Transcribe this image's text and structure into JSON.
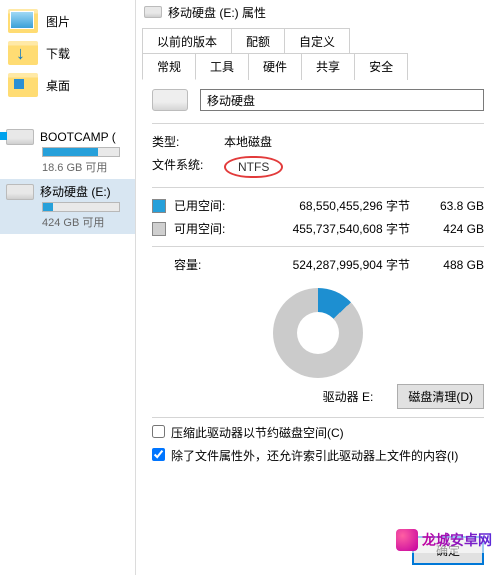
{
  "sidebar": {
    "items": [
      {
        "label": "图片"
      },
      {
        "label": "下载"
      },
      {
        "label": "桌面"
      }
    ],
    "drives": [
      {
        "name": "BOOTCAMP (",
        "meta": "18.6 GB 可用",
        "fill": 72
      },
      {
        "name": "移动硬盘 (E:)",
        "meta": "424 GB 可用",
        "fill": 13
      }
    ]
  },
  "dialog": {
    "title": "移动硬盘 (E:) 属性",
    "tabs_top": [
      "以前的版本",
      "配额",
      "自定义"
    ],
    "tabs_bottom": [
      "常规",
      "工具",
      "硬件",
      "共享",
      "安全"
    ],
    "active_tab": "常规",
    "drive_name": "移动硬盘",
    "type_label": "类型:",
    "type_value": "本地磁盘",
    "fs_label": "文件系统:",
    "fs_value": "NTFS",
    "used_label": "已用空间:",
    "used_bytes": "68,550,455,296 字节",
    "used_h": "63.8 GB",
    "free_label": "可用空间:",
    "free_bytes": "455,737,540,608 字节",
    "free_h": "424 GB",
    "cap_label": "容量:",
    "cap_bytes": "524,287,995,904 字节",
    "cap_h": "488 GB",
    "drive_e": "驱动器 E:",
    "cleanup": "磁盘清理(D)",
    "chk1": "压缩此驱动器以节约磁盘空间(C)",
    "chk2": "除了文件属性外，还允许索引此驱动器上文件的内容(I)",
    "ok": "确定"
  },
  "watermark": "龙城安卓网"
}
